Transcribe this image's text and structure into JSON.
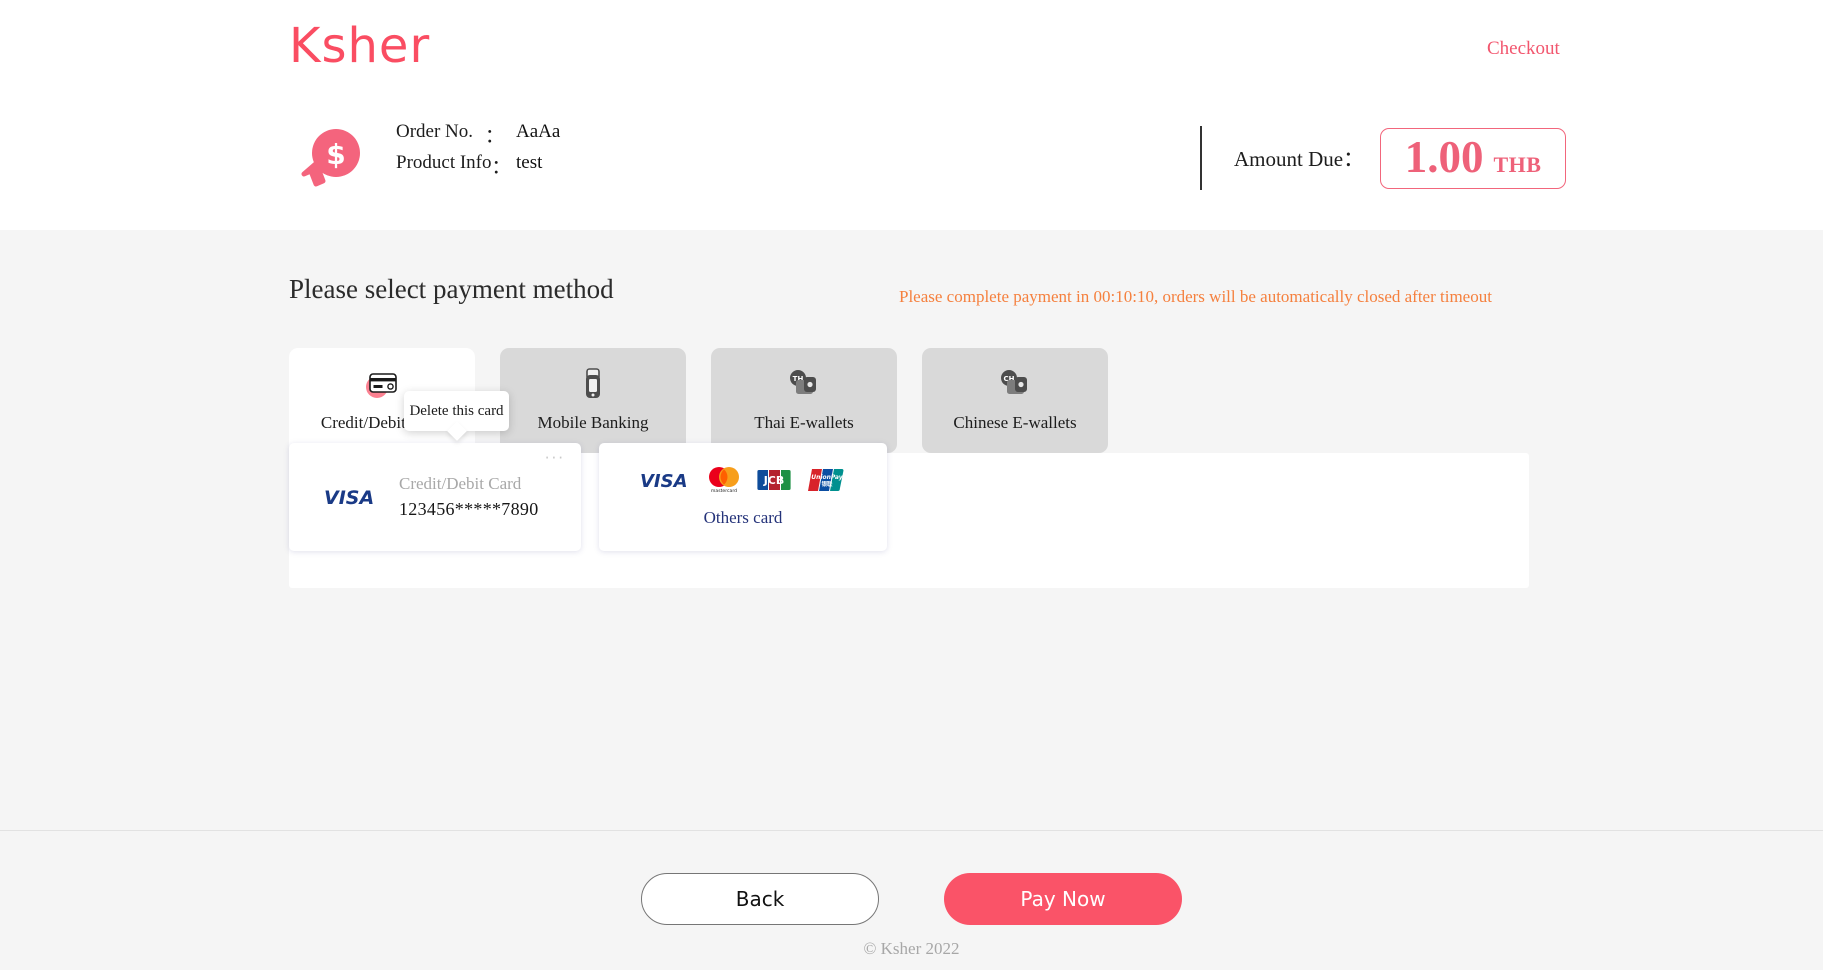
{
  "header": {
    "logo_text": "Ksher",
    "checkout_link": "Checkout"
  },
  "order": {
    "order_no_label": "Order No.",
    "order_no_value": "AaAa",
    "product_info_label": "Product Info",
    "product_info_value": "test",
    "colon": "：",
    "amount_due_label": "Amount Due：",
    "amount_value": "1.00",
    "amount_currency": "THB",
    "icon": "dollar-cursor-icon"
  },
  "main": {
    "section_title": "Please select payment method",
    "timeout_message": "Please complete payment in 00:10:10, orders will be automatically closed after timeout",
    "tabs": [
      {
        "label": "Credit/Debit Card",
        "icon": "credit-card-icon",
        "active": true
      },
      {
        "label": "Mobile Banking",
        "icon": "mobile-phone-icon",
        "active": false
      },
      {
        "label": "Thai E-wallets",
        "icon": "th-wallet-icon",
        "active": false
      },
      {
        "label": "Chinese E-wallets",
        "icon": "cn-wallet-icon",
        "active": false
      }
    ],
    "saved_card": {
      "brand": "VISA",
      "type_label": "Credit/Debit Card",
      "number": "123456*****7890",
      "menu_icon": "three-dots-icon",
      "tooltip_text": "Delete this card"
    },
    "others_card": {
      "label": "Others card",
      "brands": [
        "VISA",
        "mastercard",
        "JCB",
        "UnionPay"
      ]
    }
  },
  "footer": {
    "back_label": "Back",
    "pay_label": "Pay Now",
    "copyright": "© Ksher 2022"
  },
  "colors": {
    "brand_pink": "#fa4d62",
    "accent_pink": "#fa5368",
    "amount_pink": "#ee6179",
    "timeout_orange": "#f5803e",
    "tab_inactive": "#d9d9d9",
    "body_bg": "#f5f5f5"
  }
}
